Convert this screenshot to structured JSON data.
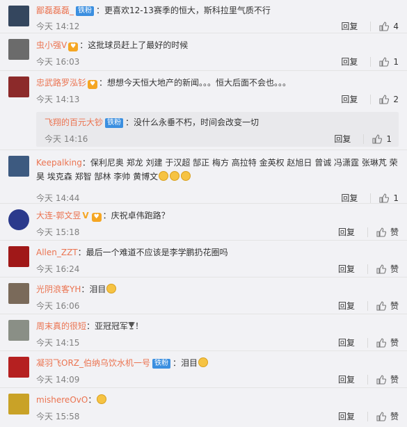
{
  "action_reply": "回复",
  "comments": [
    {
      "user": "鄙磊磊磊_",
      "badge": "铁粉",
      "text": "更喜欢12-13赛季的恒大，斯科拉里气质不行",
      "time": "今天 14:12",
      "likes": "4",
      "avatar_color": "#34465e"
    },
    {
      "user": "虫小强V",
      "vip": true,
      "text": "这批球员赶上了最好的时候",
      "time": "今天 16:03",
      "likes": "1",
      "avatar_color": "#6b6b6b"
    },
    {
      "user": "忠武路罗泓钐",
      "vip": true,
      "text": "想想今天恒大地产的新闻。。。恒大后面不会也。。。",
      "time": "今天 14:13",
      "likes": "2",
      "avatar_color": "#8c2a2a"
    },
    {
      "user": "飞翔的百元大钞",
      "badge": "铁粉",
      "text": "没什么永垂不朽，时间会改变一切",
      "time": "今天 14:16",
      "likes": "1",
      "reply_box": true
    },
    {
      "user": "Keepalking",
      "text": "保利尼奥 郑龙 刘建 于汉超 郜正 梅方 高拉特 金英权 赵旭日 曾诚 冯潇霆 张琳芃 荣昊 埃克森 郑智 郜林 李帅 黄博文",
      "emoji_count": 3,
      "time": "今天 14:44",
      "likes": "1",
      "avatar_color": "#3d5a80"
    },
    {
      "user": "大连-郭文昱",
      "vmark": "V",
      "vip": true,
      "text": "庆祝卓伟跑路？",
      "time": "今天 15:18",
      "likes": "赞",
      "avatar_color": "#2b3a8c"
    },
    {
      "user": "Allen_ZZT",
      "text": "最后一个难道不应该是李学鹏扔花圈吗",
      "time": "今天 16:24",
      "likes": "赞",
      "avatar_color": "#a01818"
    },
    {
      "user": "光阴浪客YH",
      "text": "泪目",
      "emoji_count": 1,
      "time": "今天 16:06",
      "likes": "赞",
      "avatar_color": "#7a6a5a"
    },
    {
      "user": "周末真的很短",
      "text": "亚冠冠军",
      "trophy": true,
      "tail": "！",
      "time": "今天 14:15",
      "likes": "赞",
      "avatar_color": "#8a8f86"
    },
    {
      "user": "凝羽飞ORZ_伯纳乌饮水机一号",
      "badge": "铁粉",
      "text": "泪目",
      "emoji_count": 1,
      "time": "今天 14:09",
      "likes": "赞",
      "avatar_color": "#b52020"
    },
    {
      "user": "mishereOvO",
      "text": "",
      "emoji_count": 1,
      "time": "今天 15:58",
      "likes": "赞",
      "avatar_color": "#c9a227"
    }
  ]
}
